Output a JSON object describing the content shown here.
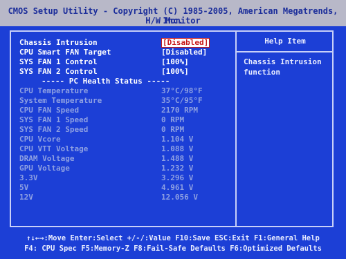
{
  "header": {
    "title": "CMOS Setup Utility - Copyright (C) 1985-2005, American Megatrends, Inc.",
    "subtitle": "H/W Monitor"
  },
  "settings": [
    {
      "label": "Chassis Intrusion",
      "value": "[Disabled]"
    },
    {
      "label": "CPU Smart FAN Target",
      "value": "[Disabled]"
    },
    {
      "label": "SYS FAN 1 Control",
      "value": "[100%]"
    },
    {
      "label": "SYS FAN 2 Control",
      "value": "[100%]"
    }
  ],
  "section_title": "----- PC Health Status -----",
  "health": [
    {
      "label": "CPU Temperature",
      "value": "37°C/98°F"
    },
    {
      "label": "System Temperature",
      "value": "35°C/95°F"
    },
    {
      "label": "CPU FAN Speed",
      "value": "2170 RPM"
    },
    {
      "label": "SYS FAN 1 Speed",
      "value": "0 RPM"
    },
    {
      "label": "SYS FAN 2 Speed",
      "value": "0 RPM"
    },
    {
      "label": "CPU Vcore",
      "value": "1.104 V"
    },
    {
      "label": "CPU VTT Voltage",
      "value": "1.088 V"
    },
    {
      "label": "DRAM Voltage",
      "value": "1.488 V"
    },
    {
      "label": "GPU Voltage",
      "value": "1.232 V"
    },
    {
      "label": "3.3V",
      "value": "3.296 V"
    },
    {
      "label": "5V",
      "value": "4.961 V"
    },
    {
      "label": "12V",
      "value": "12.056 V"
    }
  ],
  "help": {
    "title": "Help Item",
    "text": "Chassis Intrusion function"
  },
  "footer": {
    "line1": "↑↓←→:Move  Enter:Select  +/-/:Value  F10:Save  ESC:Exit  F1:General Help",
    "line2": "F4: CPU Spec  F5:Memory-Z  F8:Fail-Safe Defaults  F6:Optimized Defaults"
  },
  "colors": {
    "background": "#1c3fd6",
    "header_bar": "#b8b8c8",
    "selected_value": "#c81818",
    "dim_text": "#8ea0e2"
  }
}
